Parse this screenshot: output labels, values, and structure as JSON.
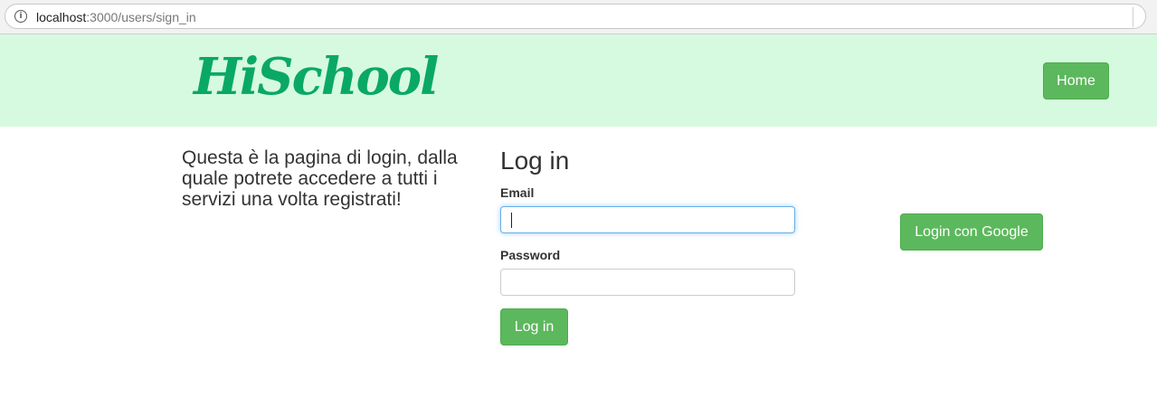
{
  "browser": {
    "url_host": "localhost",
    "url_path": ":3000/users/sign_in",
    "info_icon": "i"
  },
  "header": {
    "logo_text": "HiSchool",
    "home_label": "Home",
    "background_color": "#d6fadf",
    "logo_color": "#0aa865"
  },
  "main": {
    "intro_text": "Questa è la pagina di login, dalla quale potrete accedere a tutti i servizi una volta registrati!",
    "title": "Log in",
    "email_label": "Email",
    "email_value": "",
    "password_label": "Password",
    "password_value": "",
    "login_button": "Log in",
    "google_button": "Login con Google",
    "button_color": "#5cb85c"
  }
}
